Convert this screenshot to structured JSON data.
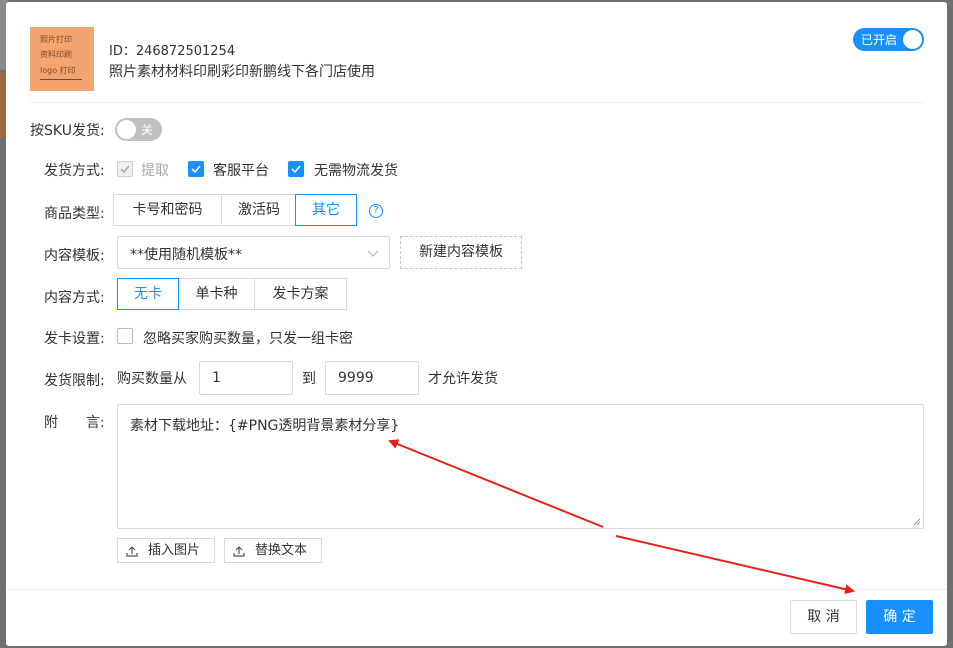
{
  "product": {
    "thumbnail_lines": [
      "照片打印",
      "资料印刷",
      "logo 打印"
    ],
    "id_label": "ID：246872501254",
    "name": "照片素材材料印刷彩印新鹏线下各门店使用",
    "enabled_label": "已开启"
  },
  "form": {
    "sku_delivery": {
      "label": "按SKU发货:",
      "toggle_label": "关"
    },
    "delivery_method": {
      "label": "发货方式:",
      "options": [
        {
          "label": "提取",
          "checked": true,
          "disabled": true
        },
        {
          "label": "客服平台",
          "checked": true,
          "disabled": false
        },
        {
          "label": "无需物流发货",
          "checked": true,
          "disabled": false
        }
      ]
    },
    "product_type": {
      "label": "商品类型:",
      "options": [
        "卡号和密码",
        "激活码",
        "其它"
      ],
      "selected": "其它",
      "help_icon": "?"
    },
    "content_template": {
      "label": "内容模板:",
      "selected": "**使用随机模板**",
      "new_button": "新建内容模板"
    },
    "content_method": {
      "label": "内容方式:",
      "options": [
        "无卡",
        "单卡种",
        "发卡方案"
      ],
      "selected": "无卡"
    },
    "card_setting": {
      "label": "发卡设置:",
      "checkbox_label": "忽略买家购买数量，只发一组卡密"
    },
    "delivery_limit": {
      "label": "发货限制:",
      "prefix": "购买数量从",
      "from": "1",
      "to_label": "到",
      "to": "9999",
      "suffix": "才允许发货"
    },
    "note": {
      "label": "附　　言:",
      "value": "素材下载地址：{#PNG透明背景素材分享}",
      "insert_image": "插入图片",
      "replace_text": "替换文本"
    }
  },
  "footer": {
    "cancel": "取 消",
    "ok": "确 定"
  },
  "colors": {
    "primary": "#1890ff",
    "annotation_arrow": "#e8201a"
  }
}
